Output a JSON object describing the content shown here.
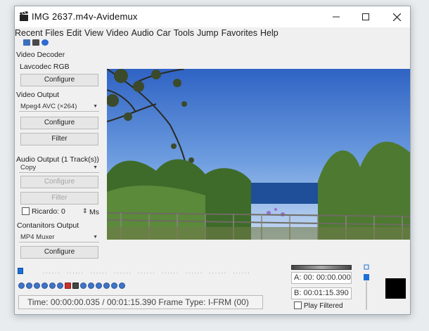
{
  "window": {
    "title": "IMG 2637.m4v-Avidemux"
  },
  "menu": [
    "Recent Files",
    "Edit",
    "View",
    "Video",
    "Audio",
    "Car",
    "Tools",
    "Jump",
    "Favorites",
    "Help"
  ],
  "video_decoder": {
    "label": "Video Decoder",
    "value": "Lavcodec RGB",
    "configure": "Configure"
  },
  "video_output": {
    "label": "Video Output",
    "codec": "Mpeg4 AVC (×264)",
    "configure": "Configure",
    "filter": "Filter"
  },
  "audio_output": {
    "label": "Audio Output (1 Track(s))",
    "codec": "Copy",
    "configure": "Configure",
    "filter": "Filter",
    "shift_label": "Ricardo: 0",
    "shift_unit": "Ms"
  },
  "container": {
    "label": "Contanitors Output",
    "value": "MP4 Muxer",
    "configure": "Configure"
  },
  "status": {
    "text": "Time: 00:00:00.035 / 00:01:15.390 Frame Type: I-FRM (00)"
  },
  "markers": {
    "a_label": "A:",
    "a_value": "00: 00:00.000",
    "b_label": "B:",
    "b_value": "00:01:15.390",
    "play_filtered": "Play Filtered"
  },
  "colors": {
    "accent": "#1d6fd8",
    "sky_top": "#2f6fcf",
    "sea": "#1d4f9a"
  }
}
